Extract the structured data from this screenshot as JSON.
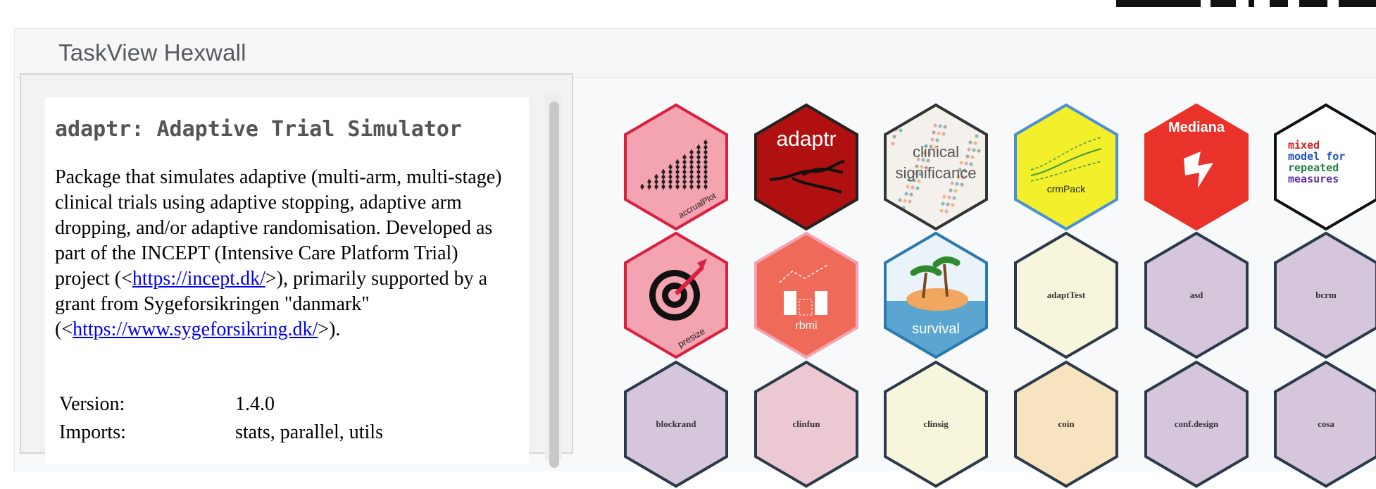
{
  "header": {
    "title": "TaskView Hexwall"
  },
  "package": {
    "title": "adaptr: Adaptive Trial Simulator",
    "desc_1": "Package that simulates adaptive (multi-arm, multi-stage) clinical trials using adaptive stopping, adaptive arm dropping, and/or adaptive randomisation. Developed as part of the INCEPT (Intensive Care Platform Trial) project (<",
    "link_1": "https://incept.dk/",
    "desc_2": ">), primarily supported by a grant from Sygeforsikringen \"danmark\" (<",
    "link_2": "https://www.sygeforsikring.dk/",
    "desc_3": ">).",
    "meta": [
      {
        "key": "Version:",
        "value": "1.4.0"
      },
      {
        "key": "Imports:",
        "value": "stats, parallel, utils"
      }
    ]
  },
  "hexes": [
    {
      "label": "accrualPlot",
      "fill": "#f4a3b0",
      "stroke": "#d9203f",
      "text_color": "#222222",
      "icon": "dot-ladder-icon"
    },
    {
      "label": "adaptr",
      "fill": "#b01010",
      "stroke": "#222222",
      "text_color": "#ffffff",
      "icon": "branching-lines-icon"
    },
    {
      "label": "clinical significance",
      "fill": "#f4f1ec",
      "stroke": "#333333",
      "text_color": "#555555",
      "icon": "scatter-dots-icon"
    },
    {
      "label": "crmPack",
      "fill": "#f3ef2a",
      "stroke": "#4a90d9",
      "text_color": "#222222",
      "icon": "curve-plot-icon"
    },
    {
      "label": "Mediana",
      "fill": "#e8322a",
      "stroke": "#e8322a",
      "text_color": "#ffffff",
      "icon": "lightning-m-icon"
    },
    {
      "label": "mixed model for repeated measures",
      "fill": "#ffffff",
      "stroke": "#111111",
      "text_color": "#111111",
      "icon": "text-logo-icon"
    },
    {
      "label": "presize",
      "fill": "#f4a3b0",
      "stroke": "#d9203f",
      "text_color": "#222222",
      "icon": "target-icon"
    },
    {
      "label": "rbmi",
      "fill": "#ef6a58",
      "stroke": "#f4a3b0",
      "text_color": "#ffffff",
      "icon": "bar-arrow-icon"
    },
    {
      "label": "survival",
      "fill": "#e9f3f9",
      "stroke": "#2a7ab0",
      "text_color": "#ffffff",
      "icon": "island-icon"
    },
    {
      "label": "adaptTest",
      "fill": "#f7f6dc",
      "stroke": "#2b3a4a",
      "text_color": "#333333",
      "icon": ""
    },
    {
      "label": "asd",
      "fill": "#d5c6dc",
      "stroke": "#2b3a4a",
      "text_color": "#333333",
      "icon": ""
    },
    {
      "label": "bcrm",
      "fill": "#d5c6dc",
      "stroke": "#2b3a4a",
      "text_color": "#333333",
      "icon": ""
    },
    {
      "label": "blockrand",
      "fill": "#d5c6dc",
      "stroke": "#2b3a4a",
      "text_color": "#333333",
      "icon": ""
    },
    {
      "label": "clinfun",
      "fill": "#ecc9d2",
      "stroke": "#2b3a4a",
      "text_color": "#333333",
      "icon": ""
    },
    {
      "label": "clinsig",
      "fill": "#f7f6dc",
      "stroke": "#2b3a4a",
      "text_color": "#333333",
      "icon": ""
    },
    {
      "label": "coin",
      "fill": "#f7e3c0",
      "stroke": "#2b3a4a",
      "text_color": "#333333",
      "icon": ""
    },
    {
      "label": "conf.design",
      "fill": "#d5c6dc",
      "stroke": "#2b3a4a",
      "text_color": "#333333",
      "icon": ""
    },
    {
      "label": "cosa",
      "fill": "#d5c6dc",
      "stroke": "#2b3a4a",
      "text_color": "#333333",
      "icon": ""
    }
  ]
}
